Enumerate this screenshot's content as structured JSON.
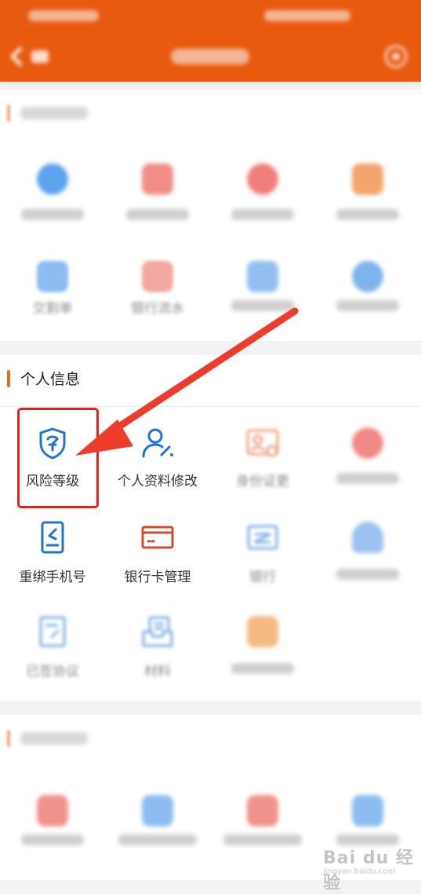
{
  "nav": {
    "title": ""
  },
  "colors": {
    "brand": "#e85a10",
    "accent_bar": "#e8691f",
    "icon_blue": "#1f73d6",
    "icon_red": "#d74a2a",
    "highlight": "#e4211f"
  },
  "section_trade": {
    "title": "",
    "row2": [
      {
        "label": "交割单",
        "icon": "document-icon"
      },
      {
        "label": "银行流水",
        "icon": "bank-statement-icon"
      },
      {
        "label": "",
        "icon": "blurred-icon"
      },
      {
        "label": "",
        "icon": "blurred-icon"
      }
    ]
  },
  "section_personal": {
    "title": "个人信息",
    "items": [
      {
        "label": "风险等级",
        "icon": "shield-icon"
      },
      {
        "label": "个人资料修改",
        "icon": "user-edit-icon"
      },
      {
        "label": "身份证更",
        "icon": "id-card-icon"
      },
      {
        "label": "",
        "icon": "blurred-icon"
      },
      {
        "label": "重绑手机号",
        "icon": "phone-icon"
      },
      {
        "label": "银行卡管理",
        "icon": "bank-card-icon"
      },
      {
        "label": "银行",
        "icon": "bank-icon"
      },
      {
        "label": "",
        "icon": "blurred-icon"
      },
      {
        "label": "已签协议",
        "icon": "signed-agreement-icon"
      },
      {
        "label": "材料",
        "icon": "materials-icon"
      },
      {
        "label": "",
        "icon": "blurred-icon"
      }
    ]
  },
  "section_account": {
    "title": ""
  },
  "watermark": {
    "main": "Bai du 经验",
    "sub": "jingyan.baidu.com"
  }
}
